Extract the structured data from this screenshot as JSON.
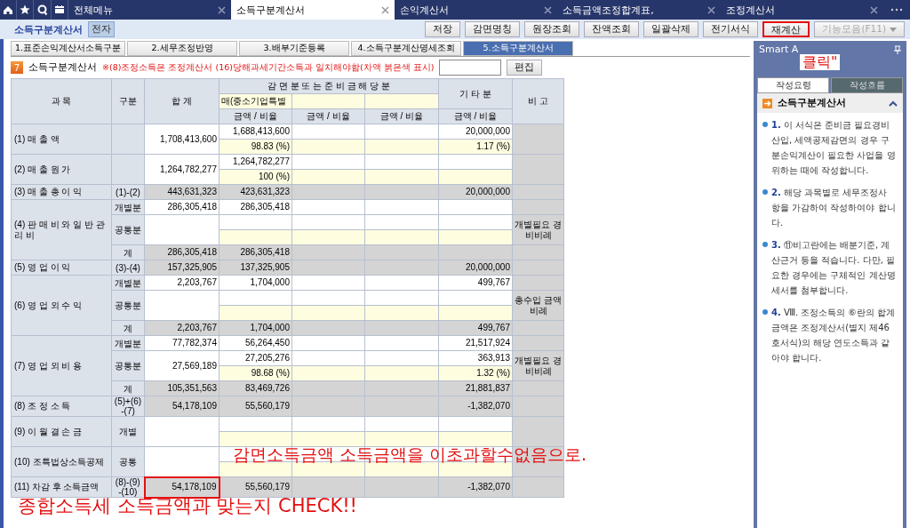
{
  "top_tabs": [
    {
      "label": "전체메뉴",
      "selected": false
    },
    {
      "label": "소득구분계산서",
      "selected": true
    },
    {
      "label": "손익계산서",
      "selected": false
    },
    {
      "label": "소득금액조정합계표,",
      "selected": false
    },
    {
      "label": "조정계산서",
      "selected": false
    }
  ],
  "toolbar": {
    "title": "소득구분계산서",
    "badge": "전자",
    "buttons": [
      {
        "label": "저장",
        "highlighted": false,
        "disabled": false
      },
      {
        "label": "감면명칭",
        "highlighted": false,
        "disabled": false
      },
      {
        "label": "원장조회",
        "highlighted": false,
        "disabled": false
      },
      {
        "label": "잔액조회",
        "highlighted": false,
        "disabled": false
      },
      {
        "label": "일괄삭제",
        "highlighted": false,
        "disabled": false
      },
      {
        "label": "전기서식",
        "highlighted": false,
        "disabled": false
      },
      {
        "label": "재계산",
        "highlighted": true,
        "disabled": false
      },
      {
        "label": "기능모음(F11)",
        "highlighted": false,
        "disabled": true
      }
    ]
  },
  "sub_tabs": [
    {
      "label": "1.표준손익계산서소득구분",
      "selected": false
    },
    {
      "label": "2.세무조정반영",
      "selected": false
    },
    {
      "label": "3.배부기준등록",
      "selected": false
    },
    {
      "label": "4.소득구분계산명세조회",
      "selected": false
    },
    {
      "label": "5.소득구분계산서",
      "selected": true
    }
  ],
  "form": {
    "number": "7",
    "title": "소득구분계산서",
    "notice": "※(8)조정소득은 조정계산서 (16)당해과세기간소득과 일치해야함(차액 붉은색 표시)",
    "edit_button": "편집"
  },
  "table": {
    "header": {
      "subject": "과 목",
      "gubun": "구분",
      "total": "합 계",
      "reduction": "감 면 분 또 는 준 비 금 해 당 분",
      "reduction_item_1": "매(중소기업특별",
      "other": "기 타 분",
      "note": "비 고",
      "amount_ratio": [
        "금액 / 비율",
        "금액 / 비율",
        "금액 / 비율",
        "금액 / 비율"
      ]
    },
    "groups": [
      {
        "label": "(1) 매 출 액",
        "parts": [
          {
            "kind": "split",
            "total": "1,708,413,600",
            "values": {
              "col_1": "1,688,413,600",
              "other": "20,000,000"
            },
            "ratios": {
              "col_1": "98.83 (%)",
              "other": "1.17 (%)"
            },
            "highlighted": false
          }
        ]
      },
      {
        "label": "(2) 매 출 원 가",
        "parts": [
          {
            "kind": "split",
            "total": "1,264,782,277",
            "values": {
              "col_1": "1,264,782,277"
            },
            "ratios": {
              "col_1": "100 (%)"
            },
            "highlighted": false
          }
        ]
      },
      {
        "label": "(3) 매 출 총 이 익",
        "parts": [
          {
            "kind": "sum",
            "gubun": "(1)-(2)",
            "total": "443,631,323",
            "values": {
              "col_1": "423,631,323",
              "other": "20,000,000"
            },
            "highlighted": false
          }
        ]
      },
      {
        "label": "(4) 판 매 비 와 일 반 관 리 비",
        "parts": [
          {
            "kind": "detail",
            "gubun": "개별분",
            "total": "286,305,418",
            "values": {
              "col_1": "286,305,418"
            },
            "highlighted": false
          },
          {
            "kind": "split",
            "gubun": "공통분",
            "note": "개별필요 경비비례",
            "highlighted": false
          },
          {
            "kind": "sum",
            "gubun": "계",
            "total": "286,305,418",
            "values": {
              "col_1": "286,305,418"
            },
            "highlighted": false
          }
        ]
      },
      {
        "label": "(5) 영 업 이 익",
        "parts": [
          {
            "kind": "sum",
            "gubun": "(3)-(4)",
            "total": "157,325,905",
            "values": {
              "col_1": "137,325,905",
              "other": "20,000,000"
            },
            "highlighted": false
          }
        ]
      },
      {
        "label": "(6) 영 업 외 수 익",
        "parts": [
          {
            "kind": "detail",
            "gubun": "개별분",
            "total": "2,203,767",
            "values": {
              "col_1": "1,704,000",
              "other": "499,767"
            },
            "highlighted": false
          },
          {
            "kind": "split",
            "gubun": "공통분",
            "note": "총수입 금액비례",
            "highlighted": false
          },
          {
            "kind": "sum",
            "gubun": "계",
            "total": "2,203,767",
            "values": {
              "col_1": "1,704,000",
              "other": "499,767"
            },
            "highlighted": false
          }
        ]
      },
      {
        "label": "(7) 영 업 외 비 용",
        "parts": [
          {
            "kind": "detail",
            "gubun": "개별분",
            "total": "77,782,374",
            "values": {
              "col_1": "56,264,450",
              "other": "21,517,924"
            },
            "highlighted": false
          },
          {
            "kind": "split",
            "gubun": "공통분",
            "total": "27,569,189",
            "values": {
              "col_1": "27,205,276",
              "other": "363,913"
            },
            "ratios": {
              "col_1": "98.68 (%)",
              "other": "1.32 (%)"
            },
            "note": "개별필요 경비비례",
            "highlighted": false
          },
          {
            "kind": "sum",
            "gubun": "계",
            "total": "105,351,563",
            "values": {
              "col_1": "83,469,726",
              "other": "21,881,837"
            },
            "highlighted": false
          }
        ]
      },
      {
        "label": "(8) 조 정 소 득",
        "parts": [
          {
            "kind": "sum",
            "gubun": "(5)+(6) -(7)",
            "total": "54,178,109",
            "values": {
              "col_1": "55,560,179",
              "other": "-1,382,070"
            },
            "highlighted": false
          }
        ]
      },
      {
        "label": "(9) 이 월 결 손 금",
        "parts": [
          {
            "kind": "split",
            "gubun": "개별",
            "highlighted": false
          }
        ]
      },
      {
        "label": "(10) 조특법상소득공제",
        "parts": [
          {
            "kind": "split",
            "gubun": "공통",
            "highlighted": false
          }
        ]
      },
      {
        "label": "(11) 차감 후 소득금액",
        "parts": [
          {
            "kind": "sum",
            "gubun": "(8)-(9) -(10)",
            "total": "54,178,109",
            "values": {
              "col_1": "55,560,179",
              "other": "-1,382,070"
            },
            "highlighted": true
          }
        ]
      }
    ]
  },
  "sidebar": {
    "title": "Smart A",
    "tabs": [
      {
        "label": "작성요령",
        "selected": true
      },
      {
        "label": "작성흐름",
        "selected": false
      }
    ],
    "heading": "소득구분계산서",
    "items": [
      {
        "number": "1.",
        "text": "이 서식은 준비금 필요경비산입, 세액공제감면의 경우 구분손익계산이 필요한 사업을 영위하는 때에 작성합니다."
      },
      {
        "number": "2.",
        "text": "해당 과목별로 세무조정사항을 가감하여 작성하여야 합니다."
      },
      {
        "number": "3.",
        "text": "⑪비고란에는 배분기준, 계산근거 등을 적습니다. 다만, 필요한 경우에는 구체적인 계산명세서를 첨부합니다."
      },
      {
        "number": "4.",
        "text": "Ⅷ. 조정소득의 ⑥란의 합계금액은 조정계산서(별지 제46호서식)의 해당 연도소득과 같아야 합니다."
      }
    ]
  },
  "annotations": [
    {
      "kind": "click",
      "text": "클릭\""
    },
    {
      "kind": "limit",
      "text": "감면소득금액 소득금액을 이초과할수없음으로."
    },
    {
      "kind": "check",
      "text": "종합소득세 소득금액과 맞는지 CHECK!!"
    }
  ]
}
